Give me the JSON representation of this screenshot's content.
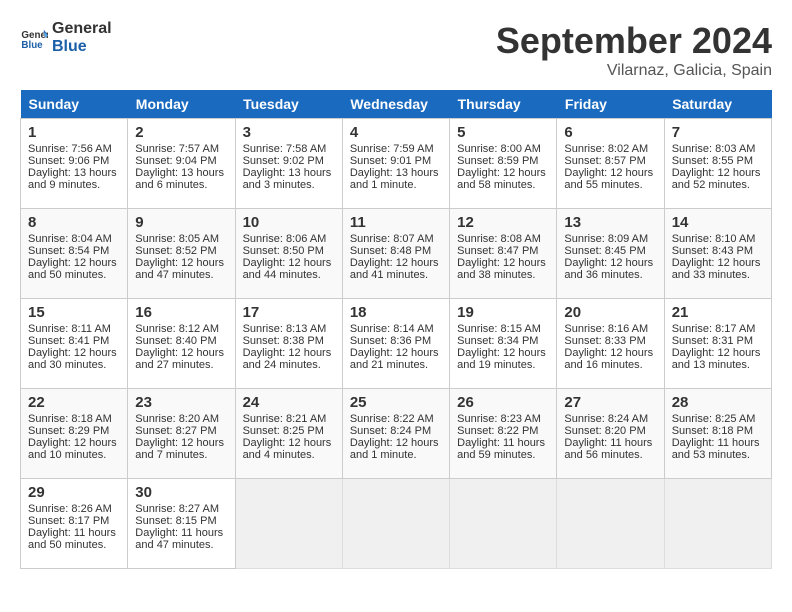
{
  "logo": {
    "line1": "General",
    "line2": "Blue"
  },
  "title": "September 2024",
  "location": "Vilarnaz, Galicia, Spain",
  "days_of_week": [
    "Sunday",
    "Monday",
    "Tuesday",
    "Wednesday",
    "Thursday",
    "Friday",
    "Saturday"
  ],
  "weeks": [
    [
      {
        "num": "1",
        "sunrise": "7:56 AM",
        "sunset": "9:06 PM",
        "daylight": "13 hours and 9 minutes."
      },
      {
        "num": "2",
        "sunrise": "7:57 AM",
        "sunset": "9:04 PM",
        "daylight": "13 hours and 6 minutes."
      },
      {
        "num": "3",
        "sunrise": "7:58 AM",
        "sunset": "9:02 PM",
        "daylight": "13 hours and 3 minutes."
      },
      {
        "num": "4",
        "sunrise": "7:59 AM",
        "sunset": "9:01 PM",
        "daylight": "13 hours and 1 minute."
      },
      {
        "num": "5",
        "sunrise": "8:00 AM",
        "sunset": "8:59 PM",
        "daylight": "12 hours and 58 minutes."
      },
      {
        "num": "6",
        "sunrise": "8:02 AM",
        "sunset": "8:57 PM",
        "daylight": "12 hours and 55 minutes."
      },
      {
        "num": "7",
        "sunrise": "8:03 AM",
        "sunset": "8:55 PM",
        "daylight": "12 hours and 52 minutes."
      }
    ],
    [
      {
        "num": "8",
        "sunrise": "8:04 AM",
        "sunset": "8:54 PM",
        "daylight": "12 hours and 50 minutes."
      },
      {
        "num": "9",
        "sunrise": "8:05 AM",
        "sunset": "8:52 PM",
        "daylight": "12 hours and 47 minutes."
      },
      {
        "num": "10",
        "sunrise": "8:06 AM",
        "sunset": "8:50 PM",
        "daylight": "12 hours and 44 minutes."
      },
      {
        "num": "11",
        "sunrise": "8:07 AM",
        "sunset": "8:48 PM",
        "daylight": "12 hours and 41 minutes."
      },
      {
        "num": "12",
        "sunrise": "8:08 AM",
        "sunset": "8:47 PM",
        "daylight": "12 hours and 38 minutes."
      },
      {
        "num": "13",
        "sunrise": "8:09 AM",
        "sunset": "8:45 PM",
        "daylight": "12 hours and 36 minutes."
      },
      {
        "num": "14",
        "sunrise": "8:10 AM",
        "sunset": "8:43 PM",
        "daylight": "12 hours and 33 minutes."
      }
    ],
    [
      {
        "num": "15",
        "sunrise": "8:11 AM",
        "sunset": "8:41 PM",
        "daylight": "12 hours and 30 minutes."
      },
      {
        "num": "16",
        "sunrise": "8:12 AM",
        "sunset": "8:40 PM",
        "daylight": "12 hours and 27 minutes."
      },
      {
        "num": "17",
        "sunrise": "8:13 AM",
        "sunset": "8:38 PM",
        "daylight": "12 hours and 24 minutes."
      },
      {
        "num": "18",
        "sunrise": "8:14 AM",
        "sunset": "8:36 PM",
        "daylight": "12 hours and 21 minutes."
      },
      {
        "num": "19",
        "sunrise": "8:15 AM",
        "sunset": "8:34 PM",
        "daylight": "12 hours and 19 minutes."
      },
      {
        "num": "20",
        "sunrise": "8:16 AM",
        "sunset": "8:33 PM",
        "daylight": "12 hours and 16 minutes."
      },
      {
        "num": "21",
        "sunrise": "8:17 AM",
        "sunset": "8:31 PM",
        "daylight": "12 hours and 13 minutes."
      }
    ],
    [
      {
        "num": "22",
        "sunrise": "8:18 AM",
        "sunset": "8:29 PM",
        "daylight": "12 hours and 10 minutes."
      },
      {
        "num": "23",
        "sunrise": "8:20 AM",
        "sunset": "8:27 PM",
        "daylight": "12 hours and 7 minutes."
      },
      {
        "num": "24",
        "sunrise": "8:21 AM",
        "sunset": "8:25 PM",
        "daylight": "12 hours and 4 minutes."
      },
      {
        "num": "25",
        "sunrise": "8:22 AM",
        "sunset": "8:24 PM",
        "daylight": "12 hours and 1 minute."
      },
      {
        "num": "26",
        "sunrise": "8:23 AM",
        "sunset": "8:22 PM",
        "daylight": "11 hours and 59 minutes."
      },
      {
        "num": "27",
        "sunrise": "8:24 AM",
        "sunset": "8:20 PM",
        "daylight": "11 hours and 56 minutes."
      },
      {
        "num": "28",
        "sunrise": "8:25 AM",
        "sunset": "8:18 PM",
        "daylight": "11 hours and 53 minutes."
      }
    ],
    [
      {
        "num": "29",
        "sunrise": "8:26 AM",
        "sunset": "8:17 PM",
        "daylight": "11 hours and 50 minutes."
      },
      {
        "num": "30",
        "sunrise": "8:27 AM",
        "sunset": "8:15 PM",
        "daylight": "11 hours and 47 minutes."
      },
      null,
      null,
      null,
      null,
      null
    ]
  ]
}
